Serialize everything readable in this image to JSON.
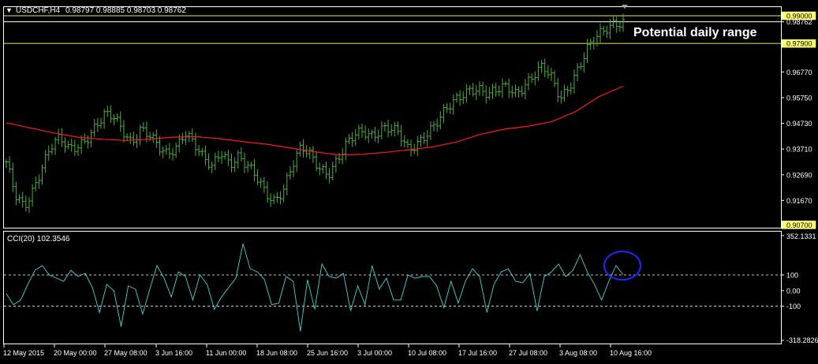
{
  "window": {
    "symbol_label": "USDCHF,H4",
    "ohlc_label": "0.98797 0.98885 0.98703 0.98762",
    "annotation": "Potential daily range"
  },
  "colors": {
    "background": "#000000",
    "bar": "#4CAF3C",
    "moving_average": "#FF1A1A",
    "cci_line": "#3FD6D6",
    "range_line": "#E8E85A",
    "axis": "#FFFFFF",
    "circle": "#1A2AFF"
  },
  "chart_data": [
    {
      "type": "bar",
      "subtype": "ohlc",
      "title": "USDCHF,H4",
      "price_ticks": [
        "0.99000",
        "0.98762",
        "0.97900",
        "0.96770",
        "0.95750",
        "0.94730",
        "0.93710",
        "0.92690",
        "0.91670",
        "0.90700"
      ],
      "highlighted_ticks": [
        "0.99000",
        "0.97900",
        "0.90700"
      ],
      "current_price": 0.98762,
      "ylim": [
        0.9065,
        0.9925
      ],
      "range_levels": [
        0.99,
        0.98762,
        0.979
      ],
      "date_ticks": [
        "12 May 2015",
        "20 May 00:00",
        "27 May 08:00",
        "3 Jun 16:00",
        "11 Jun 00:00",
        "18 Jun 08:00",
        "25 Jun 16:00",
        "3 Jul 00:00",
        "10 Jul 08:00",
        "17 Jul 16:00",
        "27 Jul 08:00",
        "3 Aug 08:00",
        "10 Aug 16:00"
      ],
      "close_series": [
        0.932,
        0.918,
        0.913,
        0.921,
        0.931,
        0.939,
        0.941,
        0.936,
        0.938,
        0.942,
        0.947,
        0.9505,
        0.949,
        0.944,
        0.94,
        0.946,
        0.943,
        0.937,
        0.934,
        0.938,
        0.945,
        0.94,
        0.933,
        0.929,
        0.936,
        0.932,
        0.935,
        0.93,
        0.925,
        0.919,
        0.917,
        0.922,
        0.931,
        0.937,
        0.934,
        0.93,
        0.928,
        0.933,
        0.938,
        0.942,
        0.944,
        0.943,
        0.946,
        0.945,
        0.942,
        0.936,
        0.94,
        0.944,
        0.947,
        0.951,
        0.955,
        0.959,
        0.962,
        0.961,
        0.958,
        0.96,
        0.962,
        0.96,
        0.963,
        0.966,
        0.969,
        0.965,
        0.958,
        0.963,
        0.969,
        0.976,
        0.981,
        0.985,
        0.988,
        0.9876
      ],
      "moving_average": [
        0.9475,
        0.9455,
        0.9435,
        0.9418,
        0.941,
        0.9405,
        0.941,
        0.9418,
        0.942,
        0.9412,
        0.94,
        0.939,
        0.9375,
        0.936,
        0.9348,
        0.935,
        0.9358,
        0.9368,
        0.938,
        0.94,
        0.943,
        0.945,
        0.9462,
        0.948,
        0.952,
        0.958,
        0.962
      ],
      "annotations": [
        "Potential daily range"
      ]
    },
    {
      "type": "line",
      "title": "CCI(20) 102.3546",
      "ylim": [
        -318.2826,
        352.1331
      ],
      "y_ticks": [
        "352.1331",
        "100",
        "0.00",
        "-100",
        "-318.2826"
      ],
      "reference_levels": [
        100,
        -100
      ],
      "series": [
        {
          "name": "CCI(20)",
          "values": [
            -20,
            -90,
            -60,
            40,
            130,
            160,
            100,
            80,
            60,
            130,
            90,
            110,
            20,
            -140,
            40,
            0,
            -230,
            30,
            10,
            -150,
            10,
            160,
            80,
            -40,
            120,
            90,
            -60,
            100,
            40,
            -120,
            -40,
            20,
            80,
            300,
            140,
            120,
            70,
            -90,
            -80,
            90,
            60,
            -260,
            70,
            -120,
            170,
            90,
            80,
            110,
            -130,
            30,
            -90,
            160,
            10,
            80,
            -60,
            -60,
            100,
            80,
            90,
            90,
            30,
            -110,
            60,
            -80,
            60,
            140,
            90,
            -140,
            40,
            120,
            140,
            60,
            50,
            110,
            -130,
            90,
            120,
            170,
            90,
            130,
            230,
            120,
            40,
            -60,
            60,
            160,
            102
          ]
        }
      ]
    }
  ]
}
